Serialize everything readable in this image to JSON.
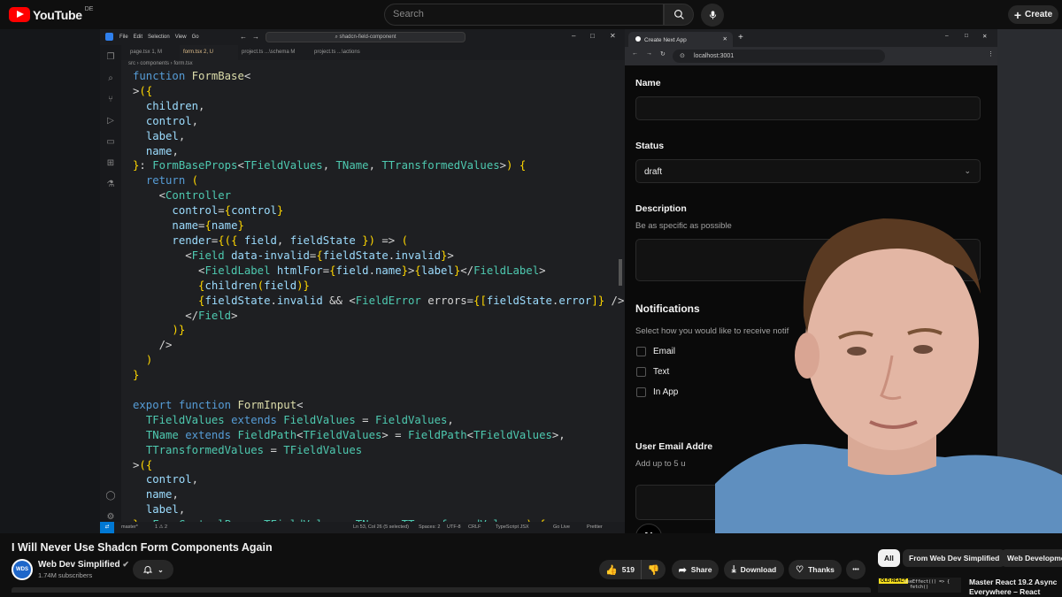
{
  "youtube": {
    "logo_text": "YouTube",
    "country_code": "DE",
    "search_placeholder": "Search",
    "create_label": "Create",
    "icons": [
      "search-icon",
      "mic-icon",
      "plus-icon"
    ]
  },
  "vscode": {
    "menu": [
      "File",
      "Edit",
      "Selection",
      "View",
      "Go"
    ],
    "command_center": "shadcn-field-component",
    "tabs": [
      {
        "label": "page.tsx",
        "meta": "1, M"
      },
      {
        "label": "form.tsx",
        "meta": "2, U"
      },
      {
        "label": "project.ts",
        "meta": "...\\schema  M"
      },
      {
        "label": "project.ts",
        "meta": "...\\actions"
      }
    ],
    "breadcrumb": "src › components › form.tsx",
    "code_lines": [
      "function FormBase<",
      ">({",
      "  children,",
      "  control,",
      "  label,",
      "  name,",
      "}: FormBaseProps<TFieldValues, TName, TTransformedValues>) {",
      "  return (",
      "    <Controller",
      "      control={control}",
      "      name={name}",
      "      render={({ field, fieldState }) => (",
      "        <Field data-invalid={fieldState.invalid}>",
      "          <FieldLabel htmlFor={field.name}>{label}</FieldLabel>",
      "          {children(field)}",
      "          {fieldState.invalid && <FieldError errors={[fieldState.error]} />}",
      "        </Field>",
      "      )}",
      "    />",
      "  )",
      "}",
      "",
      "export function FormInput<",
      "  TFieldValues extends FieldValues = FieldValues,",
      "  TName extends FieldPath<TFieldValues> = FieldPath<TFieldValues>,",
      "  TTransformedValues = TFieldValues",
      ">({",
      "  control,",
      "  name,",
      "  label,",
      "}: FormControlProps<TFieldValues, TName, TTransformedValues>) {"
    ],
    "status": {
      "branch": "master*",
      "problems": "1 ⚠ 2",
      "cursor": "Ln 53, Col 26 (5 selected)",
      "spaces": "Spaces: 2",
      "encoding": "UTF-8",
      "eol": "CRLF",
      "language": "TypeScript JSX",
      "golive": "Go Live",
      "prettier": "Prettier"
    }
  },
  "browser": {
    "tab_title": "Create Next App",
    "url": "localhost:3001",
    "form": {
      "name_label": "Name",
      "status_label": "Status",
      "status_value": "draft",
      "description_label": "Description",
      "description_hint": "Be as specific as possible",
      "notifications_label": "Notifications",
      "notifications_hint": "Select how you would like to receive notif",
      "options": [
        "Email",
        "Text",
        "In App"
      ],
      "user_email_label": "User Email Addre",
      "user_email_hint": "Add up to 5 u"
    },
    "next_logo": "N"
  },
  "video": {
    "title": "I Will Never Use Shadcn Form Components Again",
    "channel": "Web Dev Simplified",
    "channel_avatar_text": "WDS",
    "subscribers": "1.74M subscribers",
    "likes": "519",
    "share": "Share",
    "download": "Download",
    "thanks": "Thanks",
    "more": "•••"
  },
  "sidebar": {
    "chips": [
      "All",
      "From Web Dev Simplified",
      "Web Developme"
    ],
    "rec_title": "Master React 19.2 Async",
    "rec_title_2": "Everywhere – React",
    "rec_badge": "OLD REACT",
    "rec_code": "useEffect(() => {\n  fetch()"
  }
}
